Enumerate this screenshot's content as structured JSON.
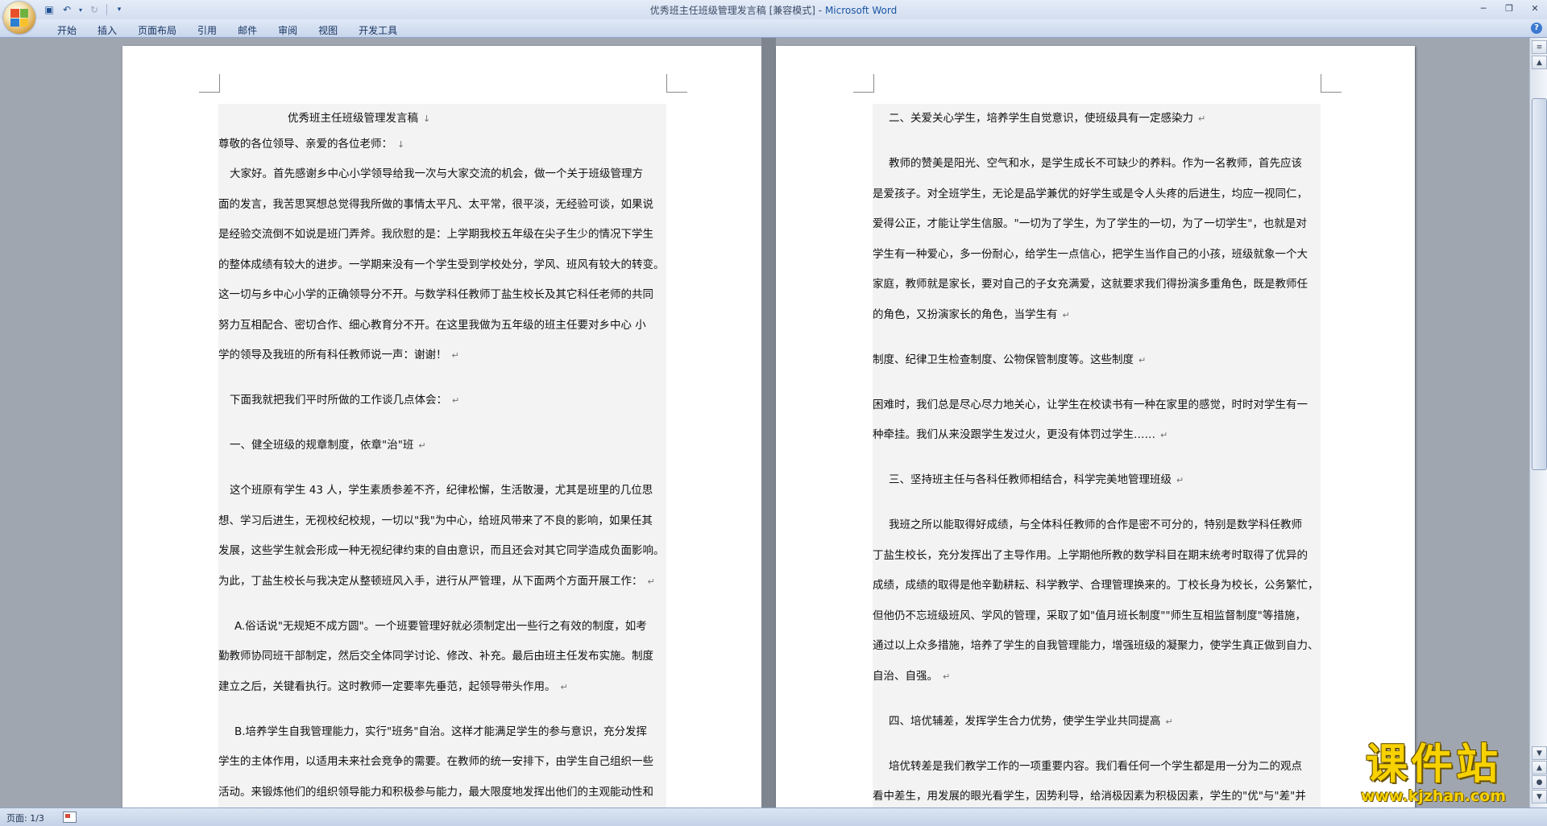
{
  "window": {
    "title_doc": "优秀班主任班级管理发言稿 [兼容模式]",
    "title_sep": " - ",
    "title_app": "Microsoft Word"
  },
  "ribbon": {
    "tabs": [
      "开始",
      "插入",
      "页面布局",
      "引用",
      "邮件",
      "审阅",
      "视图",
      "开发工具"
    ]
  },
  "left_page": {
    "title": "优秀班主任班级管理发言稿",
    "lines": [
      "尊敬的各位领导、亲爱的各位老师：",
      "大家好。首先感谢乡中心小学领导给我一次与大家交流的机会，做一个关于班级管理方",
      "面的发言，我苦思冥想总觉得我所做的事情太平凡、太平常，很平淡，无经验可谈，如果说",
      "是经验交流倒不如说是班门弄斧。我欣慰的是：上学期我校五年级在尖子生少的情况下学生",
      "的整体成绩有较大的进步。一学期来没有一个学生受到学校处分，学风、班风有较大的转变。",
      "这一切与乡中心小学的正确领导分不开。与数学科任教师丁盐生校长及其它科任老师的共同",
      "努力互相配合、密切合作、细心教育分不开。在这里我做为五年级的班主任要对乡中心 小",
      "学的领导及我班的所有科任教师说一声：谢谢！",
      "下面我就把我们平时所做的工作谈几点体会：",
      "一、健全班级的规章制度，依章\"治\"班",
      "这个班原有学生 43 人，学生素质参差不齐，纪律松懈，生活散漫，尤其是班里的几位思",
      "想、学习后进生，无视校纪校规，一切以\"我\"为中心，给班风带来了不良的影响，如果任其",
      "发展，这些学生就会形成一种无视纪律约束的自由意识，而且还会对其它同学造成负面影响。",
      "为此，丁盐生校长与我决定从整顿班风入手，进行从严管理，从下面两个方面开展工作：",
      "A.俗话说\"无规矩不成方圆\"。一个班要管理好就必须制定出一些行之有效的制度，如考",
      "勤教师协同班干部制定，然后交全体同学讨论、修改、补充。最后由班主任发布实施。制度",
      "建立之后，关键看执行。这时教师一定要率先垂范，起领导带头作用。",
      "B.培养学生自我管理能力，实行\"班务\"自治。这样才能满足学生的参与意识，充分发挥",
      "学生的主体作用，以适用未来社会竞争的需要。在教师的统一安排下，由学生自己组织一些",
      "活动。来锻炼他们的组织领导能力和积极参与能力，最大限度地发挥出他们的主观能动性和"
    ]
  },
  "right_page": {
    "lines": [
      "二、关爱关心学生，培养学生自觉意识，使班级具有一定感染力",
      "教师的赞美是阳光、空气和水，是学生成长不可缺少的养料。作为一名教师，首先应该",
      "是爱孩子。对全班学生，无论是品学兼优的好学生或是令人头疼的后进生，均应一视同仁，",
      "爱得公正，才能让学生信服。\"一切为了学生，为了学生的一切，为了一切学生\"，也就是对",
      "学生有一种爱心，多一份耐心，给学生一点信心，把学生当作自己的小孩，班级就象一个大",
      "家庭，教师就是家长，要对自己的子女充满爱，这就要求我们得扮演多重角色，既是教师任",
      "的角色，又扮演家长的角色，当学生有",
      "制度、纪律卫生检查制度、公物保管制度等。这些制度",
      "困难时，我们总是尽心尽力地关心，让学生在校读书有一种在家里的感觉，时时对学生有一",
      "种牵挂。我们从来没跟学生发过火，更没有体罚过学生……",
      "三、坚持班主任与各科任教师相结合，科学完美地管理班级",
      "我班之所以能取得好成绩，与全体科任教师的合作是密不可分的，特别是数学科任教师",
      "丁盐生校长，充分发挥出了主导作用。上学期他所教的数学科目在期末统考时取得了优异的",
      "成绩，成绩的取得是他辛勤耕耘、科学教学、合理管理换来的。丁校长身为校长，公务繁忙，",
      "但他仍不忘班级班风、学风的管理，采取了如\"值月班长制度\"\"师生互相监督制度\"等措施，",
      "通过以上众多措施，培养了学生的自我管理能力，增强班级的凝聚力，使学生真正做到自力、",
      "自治、自强。",
      "四、培优辅差，发挥学生合力优势，使学生学业共同提高",
      "培优转差是我们教学工作的一项重要内容。我们看任何一个学生都是用一分为二的观点",
      "看中差生，用发展的眼光看学生，因势利导，给消极因素为积极因素，学生的\"优\"与\"差\"并"
    ]
  },
  "paragraph_marks": {
    "down_arrow": "↓",
    "return": "↵"
  },
  "statusbar": {
    "page_info": "页面: 1/3"
  },
  "watermark": {
    "brand": "课件站",
    "url": "www.kjzhan.com"
  }
}
